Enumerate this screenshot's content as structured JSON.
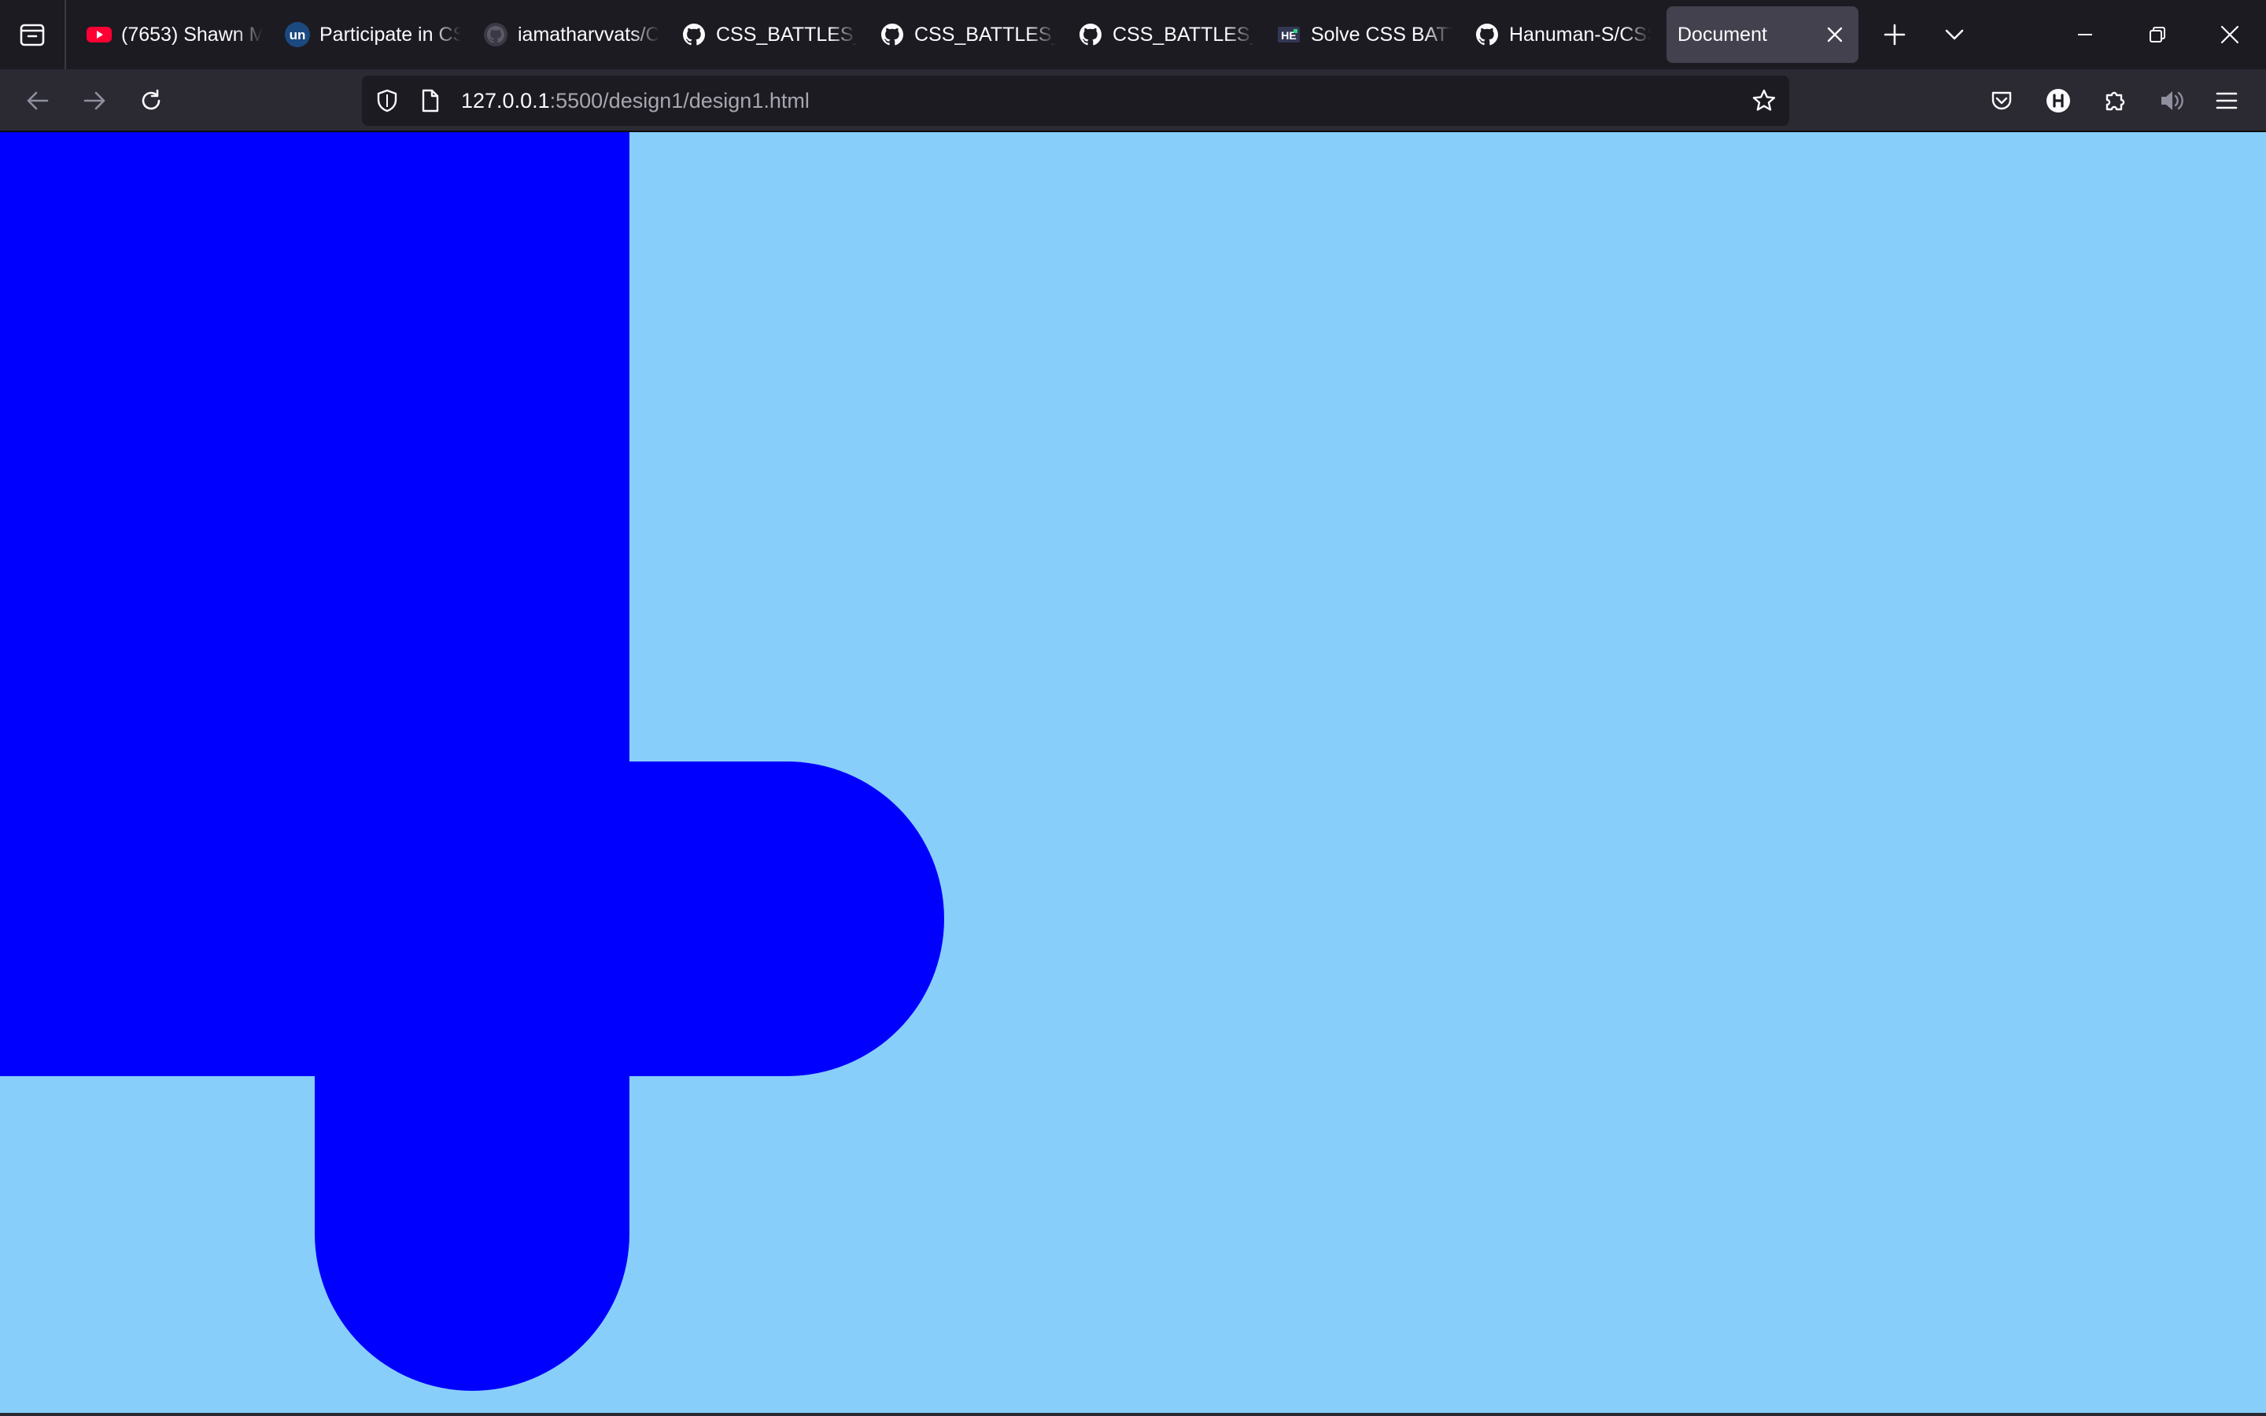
{
  "tabs": [
    {
      "title": "(7653) Shawn M",
      "icon": "youtube-icon",
      "active": false
    },
    {
      "title": "Participate in CS",
      "icon": "unstop-icon",
      "active": false
    },
    {
      "title": "iamatharvvats/C",
      "icon": "github-icon",
      "active": false
    },
    {
      "title": "CSS_BATTLES_B",
      "icon": "github-icon",
      "active": false
    },
    {
      "title": "CSS_BATTLES_B",
      "icon": "github-icon",
      "active": false
    },
    {
      "title": "CSS_BATTLES_B",
      "icon": "github-icon",
      "active": false
    },
    {
      "title": "Solve CSS BATT",
      "icon": "hackerearth-icon",
      "active": false
    },
    {
      "title": "Hanuman-S/CSS",
      "icon": "github-icon",
      "active": false
    },
    {
      "title": "Document",
      "icon": "",
      "active": true
    }
  ],
  "favicon_text": {
    "unstop": "un",
    "hackerearth": "HE"
  },
  "urlbar": {
    "host": "127.0.0.1",
    "rest": ":5500/design1/design1.html"
  },
  "page": {
    "background_color": "#87cefa",
    "shape_color": "#0000ff"
  },
  "colors": {
    "toolbar": "#2b2a33",
    "tabstrip": "#1c1b22",
    "active_tab": "#42414d",
    "text": "#fbfbfe"
  }
}
